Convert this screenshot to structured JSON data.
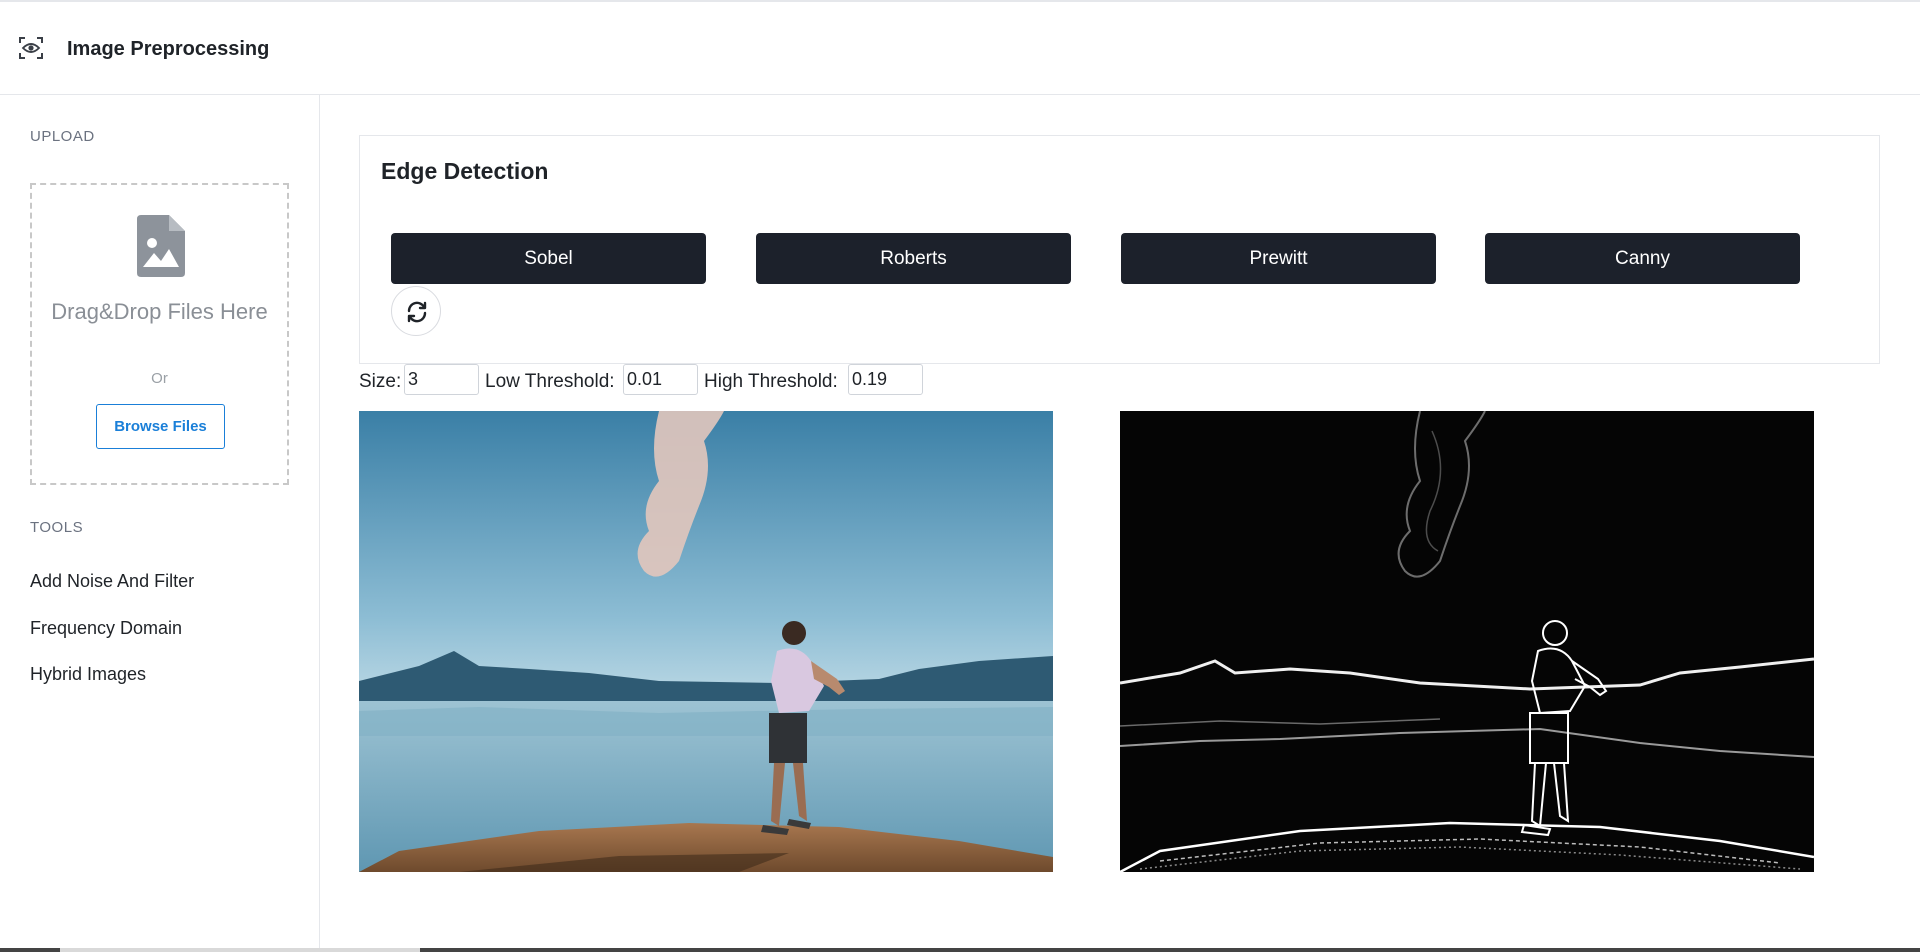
{
  "app": {
    "title": "Image Preprocessing",
    "logo_icon": "eye-scan-icon"
  },
  "sidebar": {
    "upload_label": "UPLOAD",
    "dropzone": {
      "icon": "image-file-icon",
      "text": "Drag&Drop Files Here",
      "or_text": "Or",
      "browse_label": "Browse Files"
    },
    "tools_label": "TOOLS",
    "tools": [
      {
        "label": "Add Noise And Filter"
      },
      {
        "label": "Frequency Domain"
      },
      {
        "label": "Hybrid Images"
      }
    ]
  },
  "edge_detection": {
    "title": "Edge Detection",
    "buttons": [
      {
        "label": "Sobel"
      },
      {
        "label": "Roberts"
      },
      {
        "label": "Prewitt"
      },
      {
        "label": "Canny"
      }
    ],
    "refresh_icon": "refresh-icon"
  },
  "params": {
    "size_label": "Size:",
    "size_value": "3",
    "low_label": "Low Threshold:",
    "low_value": "0.01",
    "high_label": "High Threshold:",
    "high_value": "0.19"
  },
  "colors": {
    "button_bg": "#1c212b",
    "link_blue": "#1a7fd8",
    "border": "#e5e7eb"
  }
}
